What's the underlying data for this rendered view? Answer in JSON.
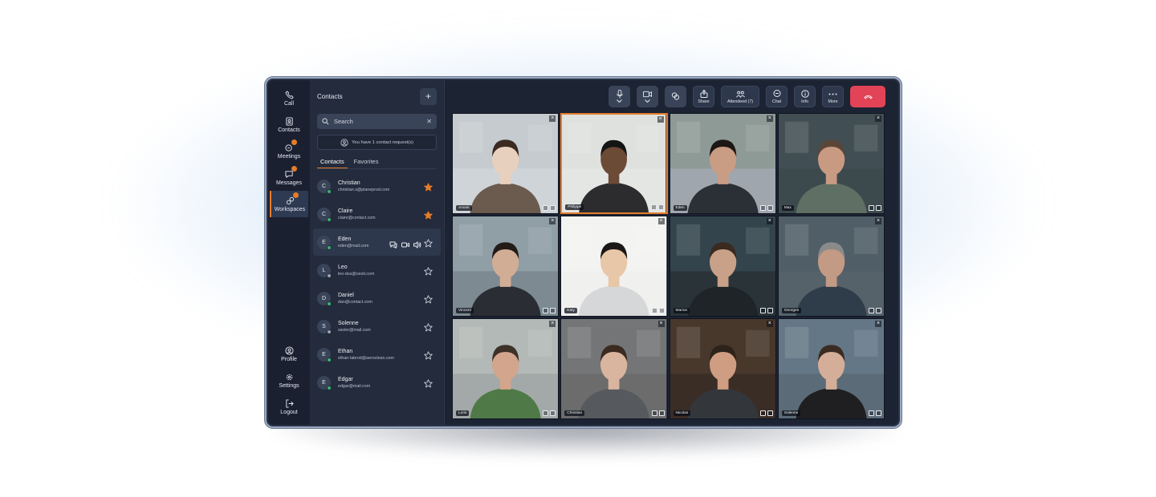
{
  "rail": {
    "items": [
      {
        "label": "Call",
        "icon": "phone-icon"
      },
      {
        "label": "Contacts",
        "icon": "contacts-icon"
      },
      {
        "label": "Meetings",
        "icon": "meetings-icon"
      },
      {
        "label": "Messages",
        "icon": "messages-icon"
      },
      {
        "label": "Workspaces",
        "icon": "workspaces-icon"
      }
    ],
    "bottom": [
      {
        "label": "Profile",
        "icon": "profile-icon"
      },
      {
        "label": "Settings",
        "icon": "gear-icon"
      },
      {
        "label": "Logout",
        "icon": "logout-icon"
      }
    ]
  },
  "contacts_panel": {
    "title": "Contacts",
    "search_placeholder": "Search",
    "request_text": "You have 1 contact request(s)",
    "tabs": [
      "Contacts",
      "Favorites"
    ],
    "contacts": [
      {
        "initial": "C",
        "name": "Christian",
        "email": "christian.s@planeprod.com",
        "favorite": true,
        "status": "online"
      },
      {
        "initial": "C",
        "name": "Claire",
        "email": "claire@contact.com",
        "favorite": true,
        "status": "online"
      },
      {
        "initial": "E",
        "name": "Eden",
        "email": "eden@mail.com",
        "favorite": false,
        "status": "online"
      },
      {
        "initial": "L",
        "name": "Leo",
        "email": "leo-dus@oexit.com",
        "favorite": false,
        "status": "offline"
      },
      {
        "initial": "D",
        "name": "Daniel",
        "email": "dan@contact.com",
        "favorite": false,
        "status": "online"
      },
      {
        "initial": "S",
        "name": "Solenne",
        "email": "ssoler@mail.com",
        "favorite": false,
        "status": "offline"
      },
      {
        "initial": "E",
        "name": "Ethan",
        "email": "ethan-labrod@aeroclean.com",
        "favorite": false,
        "status": "online"
      },
      {
        "initial": "E",
        "name": "Edgar",
        "email": "edgar@mail.com",
        "favorite": false,
        "status": "online"
      }
    ]
  },
  "toolbar": {
    "share": "Share",
    "attendees": "Attendeed (7)",
    "chat": "Chat",
    "info": "Info",
    "more": "More"
  },
  "participants": [
    "Anouk",
    "Philippe",
    "Eden",
    "Max",
    "Vincent",
    "Katy",
    "Marion",
    "Georges",
    "Loris",
    "Christian",
    "Nicolas",
    "Solenne"
  ],
  "colors": {
    "accent": "#e57c2b",
    "end_call": "#e24356",
    "online": "#3bb26b",
    "offline": "#9aa3b2"
  }
}
